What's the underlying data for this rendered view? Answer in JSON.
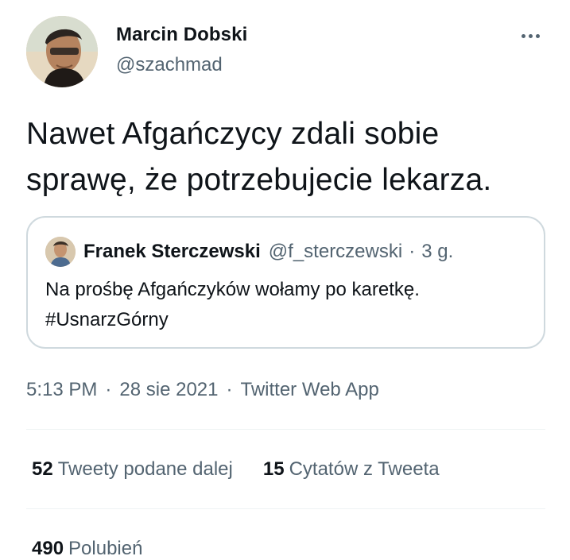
{
  "tweet": {
    "author": {
      "display_name": "Marcin Dobski",
      "handle": "@szachmad",
      "avatar": "avatar-photo"
    },
    "more_icon": "more-horizontal-icon",
    "text": "Nawet Afgańczycy zdali sobie sprawę, że potrzebujecie lekarza.",
    "quote": {
      "display_name": "Franek Sterczewski",
      "handle": "@f_sterczewski",
      "separator": "·",
      "time": "3 g.",
      "text_line1": "Na prośbę Afgańczyków wołamy po karetkę.",
      "text_line2": "#UsnarzGórny",
      "avatar": "avatar-photo"
    },
    "meta": {
      "time": "5:13 PM",
      "date": "28 sie 2021",
      "source": "Twitter Web App",
      "separator": "·"
    },
    "stats": {
      "retweets_count": "52",
      "retweets_label": "Tweety podane dalej",
      "quotes_count": "15",
      "quotes_label": "Cytatów z Tweeta",
      "likes_count": "490",
      "likes_label": "Polubień"
    }
  },
  "colors": {
    "text_primary": "#0f1419",
    "text_secondary": "#536471",
    "border": "#cfd9de",
    "divider": "#eff3f4",
    "background": "#ffffff"
  }
}
